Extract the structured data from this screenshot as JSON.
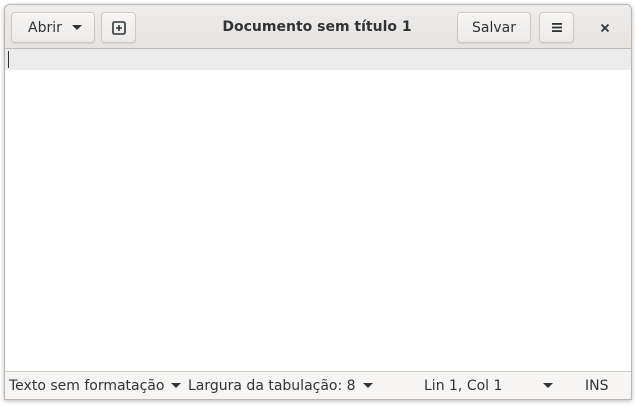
{
  "header": {
    "open_label": "Abrir",
    "title": "Documento sem título 1",
    "save_label": "Salvar",
    "new_tab_icon": "new-tab-icon",
    "menu_icon": "hamburger-menu-icon",
    "close_icon": "close-icon"
  },
  "editor": {
    "content": ""
  },
  "statusbar": {
    "language": "Texto sem formatação",
    "tab_width": "Largura da tabulação: 8",
    "position": "Lin 1, Col 1",
    "insert_mode": "INS"
  },
  "colors": {
    "headerbar": "#e8e6e3",
    "current_line": "#ececec",
    "statusbar": "#f6f5f4",
    "text": "#2e3436"
  }
}
